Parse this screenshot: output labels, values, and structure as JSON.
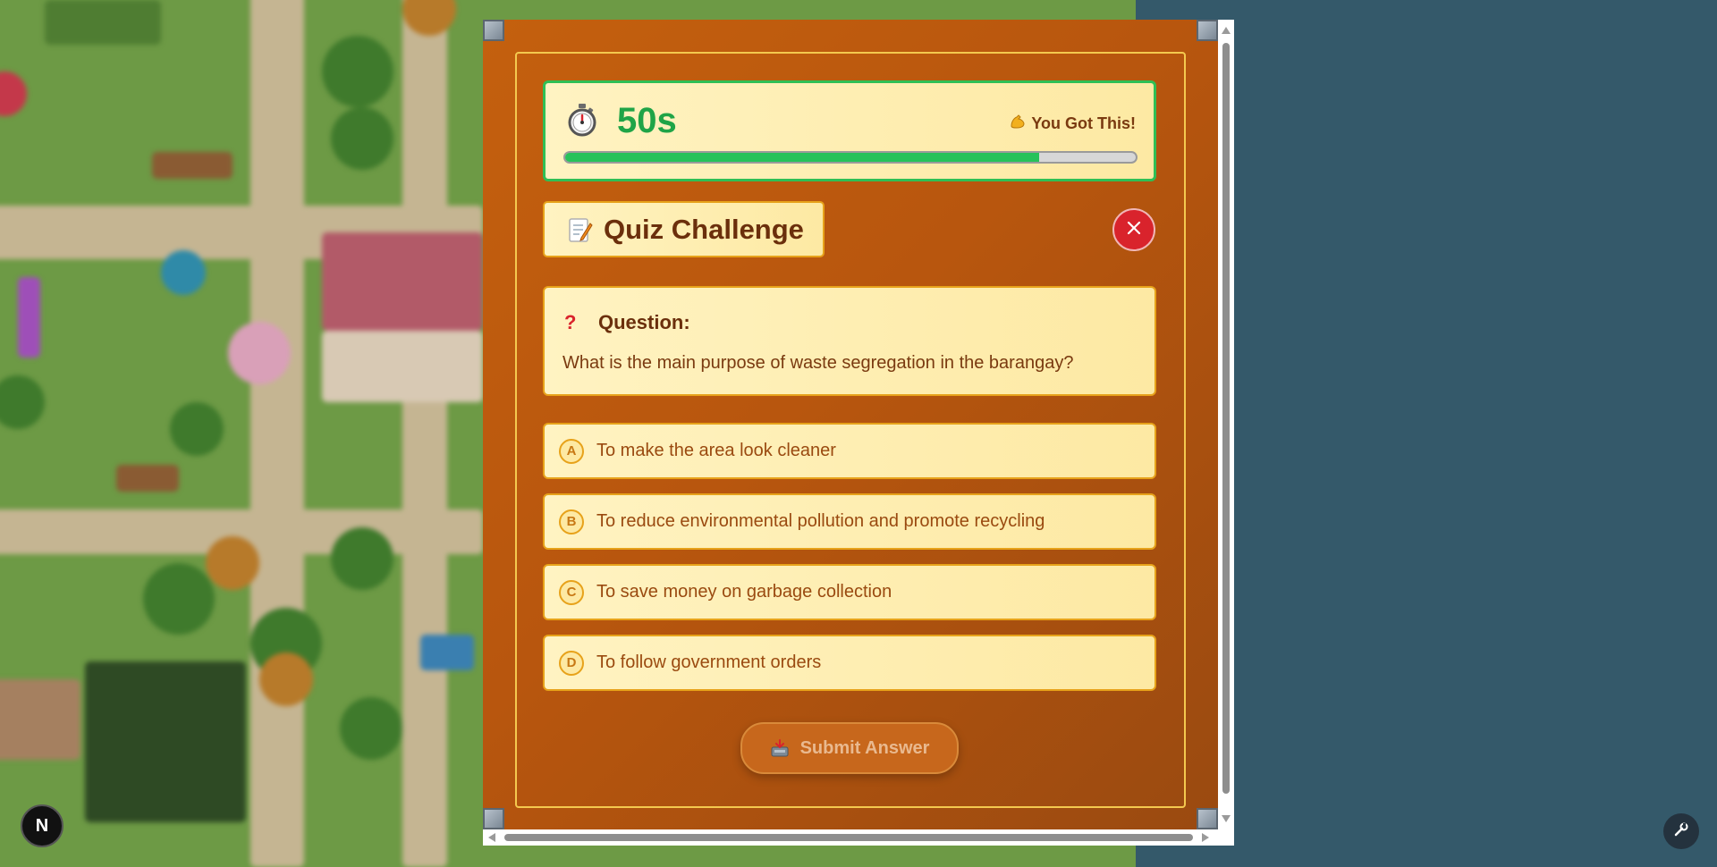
{
  "timer": {
    "value": "50s",
    "encouragement": "You Got This!",
    "encouragement_icon": "flexed-biceps-icon",
    "stopwatch_icon": "stopwatch-icon",
    "progress": 0.83,
    "progress_color": "#26c25a",
    "border_color": "#2fbf55"
  },
  "quiz": {
    "title": "Quiz Challenge",
    "title_icon": "memo-icon",
    "close_icon": "close-icon",
    "question_label": "Question:",
    "question_icon_glyph": "?",
    "question_text": "What is the main purpose of waste segregation in the barangay?",
    "options": [
      {
        "letter": "A",
        "text": "To make the area look cleaner"
      },
      {
        "letter": "B",
        "text": "To reduce environmental pollution and promote recycling"
      },
      {
        "letter": "C",
        "text": "To save money on garbage collection"
      },
      {
        "letter": "D",
        "text": "To follow government orders"
      }
    ],
    "submit_label": "Submit Answer",
    "submit_icon": "inbox-tray-icon"
  },
  "badges": {
    "next_badge": "N",
    "tools_icon": "wrench-icon"
  },
  "colors": {
    "panel": "#b8560e",
    "card_bg": "#fde9a3",
    "accent_gold": "#e7a21a",
    "close_red": "#d9232c",
    "backdrop": "#34596a"
  }
}
